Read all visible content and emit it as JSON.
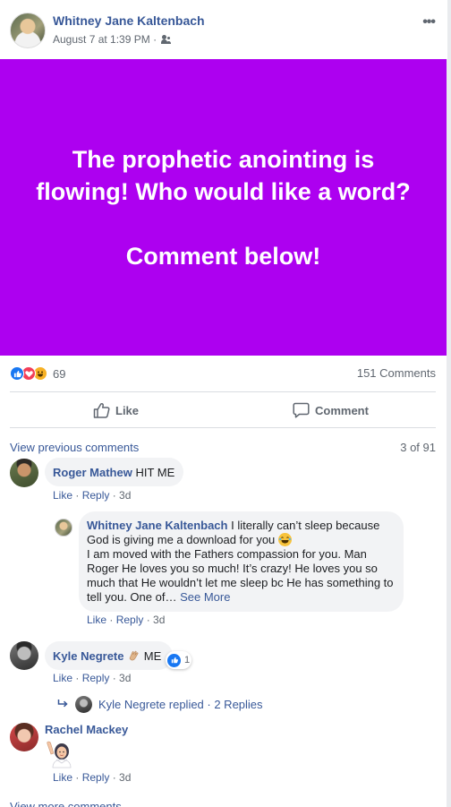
{
  "post": {
    "author": "Whitney Jane Kaltenbach",
    "timestamp": "August 7 at 1:39 PM · ",
    "audience_icon": "friends-icon",
    "more_icon": "•••",
    "image_text": "The prophetic anointing is flowing! Who would like a word?\n\nComment below!",
    "image_bg": "#ad00f0",
    "reaction_count": "69",
    "comments_count": "151 Comments",
    "actions": {
      "like": "Like",
      "comment": "Comment"
    }
  },
  "comments_section": {
    "view_previous": "View previous comments",
    "pager": "3 of 91",
    "view_more": "View more comments",
    "items": [
      {
        "name": "Roger Mathew",
        "text": "HIT ME",
        "like": "Like",
        "reply": "Reply",
        "time": "3d"
      },
      {
        "name": "Whitney Jane Kaltenbach",
        "text_1": "I literally can’t sleep because God is giving me a download for you",
        "emoji": "laughing-tears-emoji",
        "text_2": "I am moved with the Fathers compassion for you. Man Roger He loves you so much! It’s crazy! He loves you so much that He wouldn’t let me sleep bc He has something to tell you. One of…",
        "see_more": "See More",
        "like": "Like",
        "reply": "Reply",
        "time": "3d"
      },
      {
        "name": "Kyle Negrete",
        "emoji": "clapping-hands-emoji",
        "text": "ME",
        "like_badge_count": "1",
        "like": "Like",
        "reply": "Reply",
        "time": "3d",
        "replies_link": "Kyle Negrete replied · 2 Replies"
      },
      {
        "name": "Rachel Mackey",
        "sticker": "raising-hand-woman-emoji",
        "like": "Like",
        "reply": "Reply",
        "time": "3d"
      }
    ]
  },
  "colors": {
    "link": "#385898",
    "meta": "#606770",
    "bubble": "#f2f3f5",
    "like_blue": "#1877f2"
  }
}
